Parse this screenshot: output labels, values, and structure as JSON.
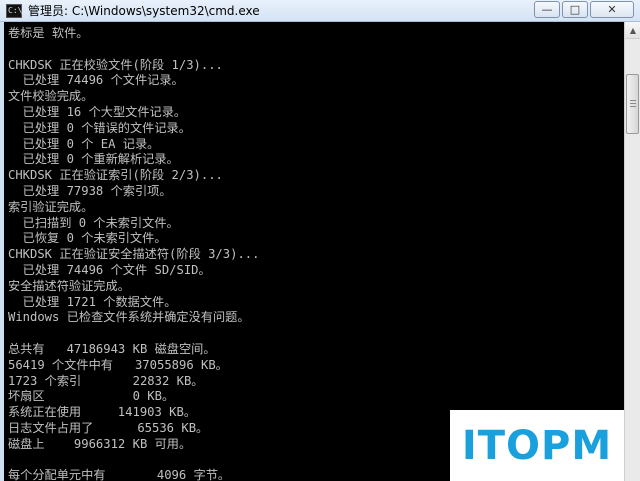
{
  "window": {
    "title": "管理员: C:\\Windows\\system32\\cmd.exe",
    "app_icon_text": "C:\\",
    "controls": {
      "minimize": "—",
      "maximize": "□",
      "close": "✕"
    }
  },
  "console": {
    "lines": [
      "卷标是 软件。",
      "",
      "CHKDSK 正在校验文件(阶段 1/3)...",
      "  已处理 74496 个文件记录。",
      "文件校验完成。",
      "  已处理 16 个大型文件记录。",
      "  已处理 0 个错误的文件记录。",
      "  已处理 0 个 EA 记录。",
      "  已处理 0 个重新解析记录。",
      "CHKDSK 正在验证索引(阶段 2/3)...",
      "  已处理 77938 个索引项。",
      "索引验证完成。",
      "  已扫描到 0 个未索引文件。",
      "  已恢复 0 个未索引文件。",
      "CHKDSK 正在验证安全描述符(阶段 3/3)...",
      "  已处理 74496 个文件 SD/SID。",
      "安全描述符验证完成。",
      "  已处理 1721 个数据文件。",
      "Windows 已检查文件系统并确定没有问题。",
      "",
      "总共有   47186943 KB 磁盘空间。",
      "56419 个文件中有   37055896 KB。",
      "1723 个索引       22832 KB。",
      "坏扇区            0 KB。",
      "系统正在使用     141903 KB。",
      "日志文件占用了      65536 KB。",
      "磁盘上    9966312 KB 可用。",
      "",
      "每个分配单元中有       4096 字节。"
    ]
  },
  "scrollbar": {
    "up_arrow": "▲"
  },
  "watermark": {
    "text": "ITOPM"
  },
  "colors": {
    "console_bg": "#000000",
    "console_text": "#c0c0c0",
    "watermark": "#1aa0dc"
  }
}
